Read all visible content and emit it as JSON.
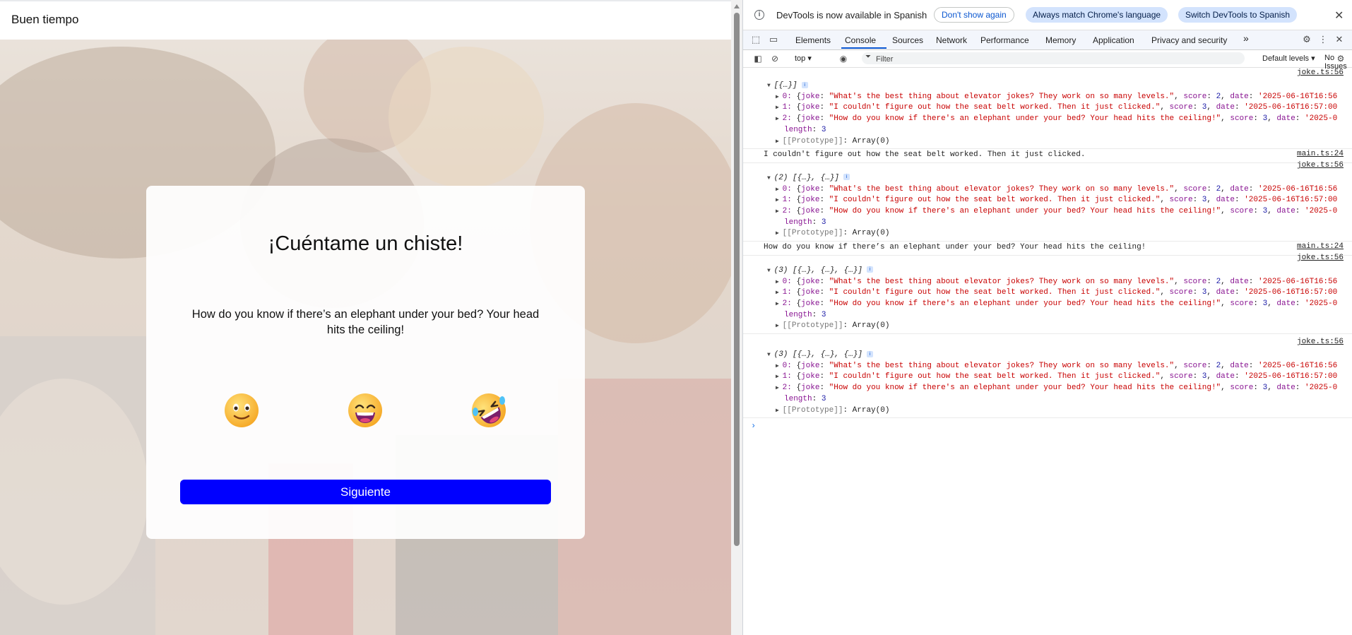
{
  "app": {
    "title": "Buen tiempo",
    "card": {
      "heading": "¡Cuéntame un chiste!",
      "joke": "How do you know if there’s an elephant under your bed? Your head hits the ceiling!",
      "emoji_icons": [
        "slightly-smiling-face-icon",
        "grinning-face-icon",
        "rolling-on-the-floor-laughing-icon"
      ],
      "next_button": "Siguiente"
    },
    "colors": {
      "button": "#0000ff"
    }
  },
  "devtools": {
    "infobar": {
      "message": "DevTools is now available in Spanish",
      "dont_show": "Don't show again",
      "always_match": "Always match Chrome's language",
      "switch": "Switch DevTools to Spanish"
    },
    "tabs": [
      "Elements",
      "Console",
      "Sources",
      "Network",
      "Performance",
      "Memory",
      "Application",
      "Privacy and security"
    ],
    "active_tab": "Console",
    "more_tabs": "»",
    "toolbar": {
      "context": "top ▾",
      "filter_placeholder": "Filter",
      "levels": "Default levels ▾",
      "issues": "No Issues"
    },
    "console": {
      "jokes": [
        {
          "joke": "What's the best thing about elevator jokes? They work on so many levels.",
          "score": "2",
          "date": "'2025-06-16T16:56"
        },
        {
          "joke": "I couldn't figure out how the seat belt worked. Then it just clicked.",
          "score": "3",
          "date": "'2025-06-16T16:57:00"
        },
        {
          "joke": "How do you know if there's an elephant under your bed? Your head hits the ceiling!",
          "score": "3",
          "date": "'2025-0"
        }
      ],
      "groups": [
        {
          "source": "joke.ts:56",
          "header": "[{…}]"
        },
        {
          "source": "joke.ts:56",
          "header": "(2) [{…}, {…}]"
        },
        {
          "source": "joke.ts:56",
          "header": "(3) [{…}, {…}, {…}]"
        },
        {
          "source": "joke.ts:56",
          "header": "(3) [{…}, {…}, {…}]"
        }
      ],
      "logs": [
        {
          "text": "I couldn't figure out how the seat belt worked. Then it just clicked.",
          "source": "main.ts:24"
        },
        {
          "text": "How do you know if there’s an elephant under your bed? Your head hits the ceiling!",
          "source": "main.ts:24"
        }
      ],
      "length_label": "length",
      "length_value": "3",
      "prototype_label": "[[Prototype]]",
      "prototype_value": "Array(0)"
    }
  }
}
